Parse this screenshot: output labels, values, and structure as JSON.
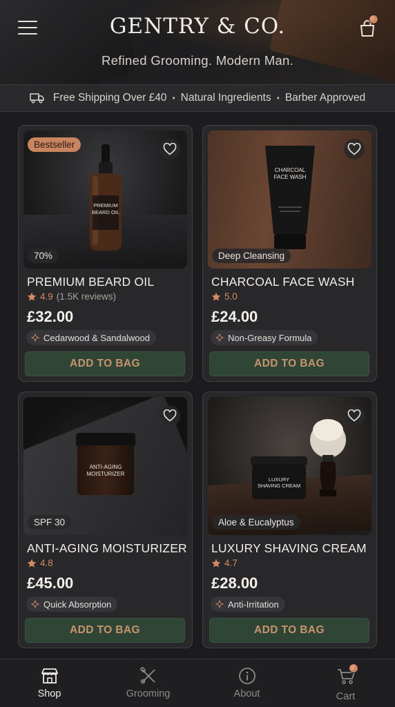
{
  "header": {
    "brand": "GENTRY & CO.",
    "tagline": "Refined Grooming. Modern Man."
  },
  "info_strip": {
    "items": [
      "Free Shipping Over £40",
      "Natural Ingredients",
      "Barber Approved"
    ]
  },
  "products": [
    {
      "badge": "Bestseller",
      "image_chip": "70%",
      "bottle_label": "PREMIUM\nBEARD OIL",
      "name": "PREMIUM BEARD OIL",
      "rating": "4.9",
      "reviews": "(1.5K reviews)",
      "price": "£32.00",
      "feature": "Cedarwood & Sandalwood",
      "cta": "ADD TO BAG"
    },
    {
      "image_chip": "Deep Cleansing",
      "bottle_label": "CHARCOAL\nFACE WASH",
      "name": "CHARCOAL FACE WASH",
      "rating": "5.0",
      "price": "£24.00",
      "feature": "Non-Greasy Formula",
      "cta": "ADD TO BAG"
    },
    {
      "image_chip": "SPF 30",
      "bottle_label": "ANTI-AGING\nMOISTURIZER",
      "name": "ANTI-AGING MOISTURIZER",
      "rating": "4.8",
      "price": "£45.00",
      "feature": "Quick Absorption",
      "cta": "ADD TO BAG"
    },
    {
      "image_chip": "Aloe & Eucalyptus",
      "bottle_label": "LUXURY\nSHAVING CREAM",
      "name": "LUXURY SHAVING CREAM",
      "rating": "4.7",
      "price": "£28.00",
      "feature": "Anti-Irritation",
      "cta": "ADD TO BAG"
    }
  ],
  "bottom_nav": {
    "items": [
      {
        "label": "Shop",
        "icon": "storefront-icon",
        "active": true
      },
      {
        "label": "Grooming",
        "icon": "razor-scissors-icon",
        "active": false
      },
      {
        "label": "About",
        "icon": "info-icon",
        "active": false
      },
      {
        "label": "Cart",
        "icon": "cart-icon",
        "active": false
      }
    ]
  },
  "colors": {
    "accent_copper": "#c9855f",
    "button_green": "#2f4535",
    "star": "#d48a62",
    "background": "#1c1c1e"
  }
}
